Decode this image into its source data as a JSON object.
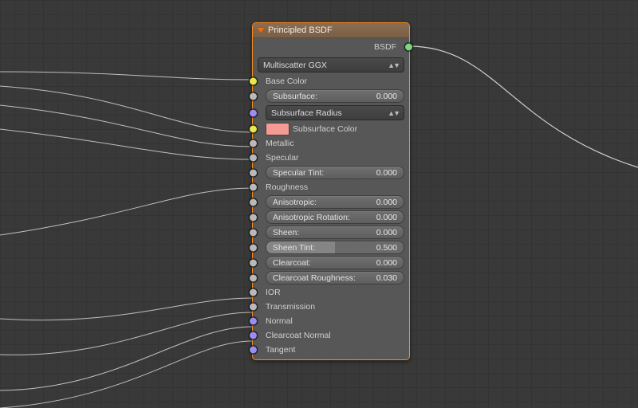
{
  "node": {
    "title": "Principled BSDF",
    "output_label": "BSDF",
    "distribution": "Multiscatter GGX",
    "subsurface_radius_label": "Subsurface Radius",
    "subsurface_color_label": "Subsurface Color",
    "subsurface_color_value": "#f59a95",
    "inputs": {
      "base_color": "Base Color",
      "subsurface": {
        "label": "Subsurface:",
        "value": "0.000"
      },
      "metallic": "Metallic",
      "specular": "Specular",
      "specular_tint": {
        "label": "Specular Tint:",
        "value": "0.000"
      },
      "roughness": "Roughness",
      "anisotropic": {
        "label": "Anisotropic:",
        "value": "0.000"
      },
      "anisotropic_rot": {
        "label": "Anisotropic Rotation:",
        "value": "0.000"
      },
      "sheen": {
        "label": "Sheen:",
        "value": "0.000"
      },
      "sheen_tint": {
        "label": "Sheen Tint:",
        "value": "0.500"
      },
      "clearcoat": {
        "label": "Clearcoat:",
        "value": "0.000"
      },
      "clearcoat_rough": {
        "label": "Clearcoat Roughness:",
        "value": "0.030"
      },
      "ior": "IOR",
      "transmission": "Transmission",
      "normal": "Normal",
      "clearcoat_normal": "Clearcoat Normal",
      "tangent": "Tangent"
    }
  }
}
